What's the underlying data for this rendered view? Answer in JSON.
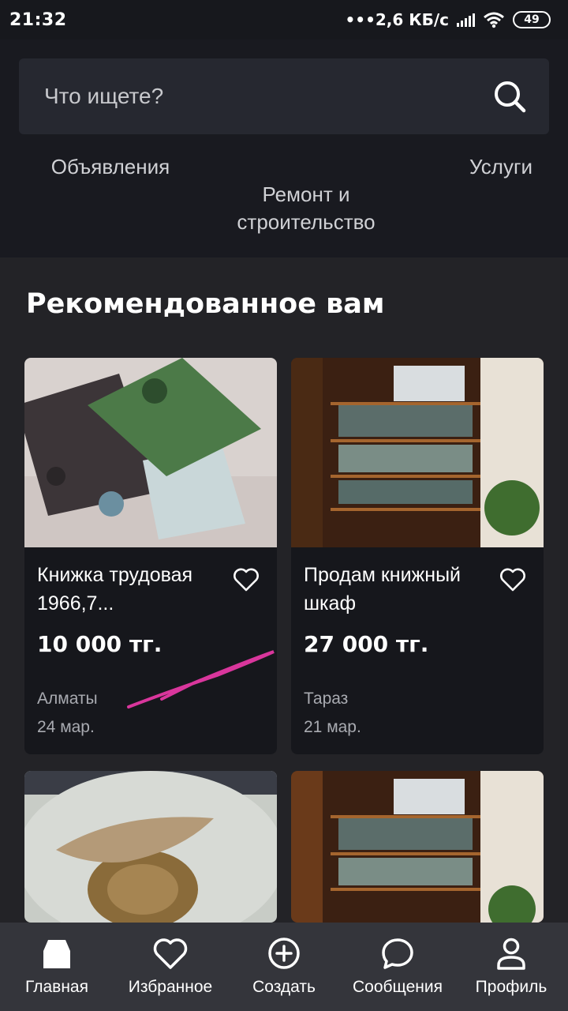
{
  "status_bar": {
    "time": "21:32",
    "network_speed": "•••2,6 КБ/с",
    "battery": "49"
  },
  "search": {
    "placeholder": "Что ищете?"
  },
  "categories": [
    {
      "label": "Объявления"
    },
    {
      "label": "Ремонт и\nстроительство"
    },
    {
      "label": "Услуги"
    }
  ],
  "recommended": {
    "title": "Рекомендованное вам",
    "listings": [
      {
        "title": "Книжка трудовая 1966,7...",
        "price": "10 000 тг.",
        "city": "Алматы",
        "date": "24 мар."
      },
      {
        "title": "Продам книжный шкаф",
        "price": "27 000 тг.",
        "city": "Тараз",
        "date": "21 мар."
      }
    ]
  },
  "bottom_nav": [
    {
      "label": "Главная",
      "icon": "home-icon"
    },
    {
      "label": "Избранное",
      "icon": "heart-icon"
    },
    {
      "label": "Создать",
      "icon": "plus-circle-icon"
    },
    {
      "label": "Сообщения",
      "icon": "chat-bubble-icon"
    },
    {
      "label": "Профиль",
      "icon": "user-icon"
    }
  ],
  "colors": {
    "background": "#232327",
    "header": "#191a20",
    "card": "#16171c",
    "nav": "#34353b",
    "scribble": "#d9369c"
  }
}
